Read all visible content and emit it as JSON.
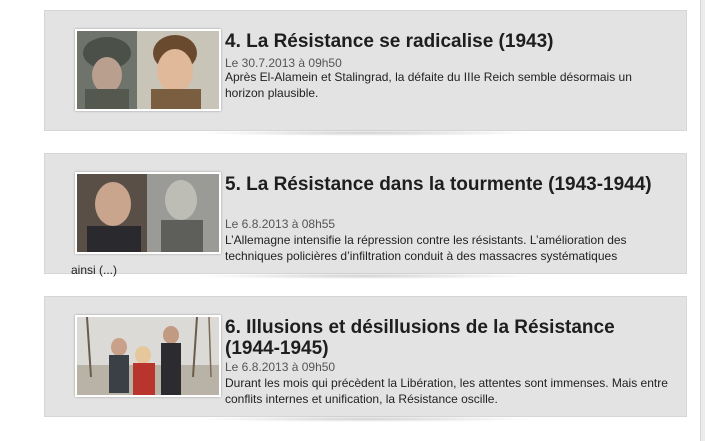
{
  "articles": [
    {
      "title": "4. La Résistance se radicalise (1943)",
      "date": "Le 30.7.2013 à 09h50",
      "summary": "Après El-Alamein et Stalingrad, la défaite du IIIe Reich semble désormais un horizon plausible.",
      "thumbnail": "soldier-and-young-man-still"
    },
    {
      "title": "5. La Résistance dans la tourmente (1943-1944)",
      "date": "Le 6.8.2013 à 08h55",
      "summary": "L’Allemagne intensifie la répression contre les résistants. L’amélioration des techniques policières d’infiltration conduit à des massacres systématiques",
      "overflow": "ainsi (...)",
      "thumbnail": "old-man-and-portrait-still"
    },
    {
      "title": "6. Illusions et désillusions de la Résistance (1944-1945)",
      "date": "Le 6.8.2013 à 09h50",
      "summary": "Durant les mois qui précèdent la Libération, les attentes sont immenses. Mais entre conflits internes et unification, la Résistance oscille.",
      "thumbnail": "group-in-winter-forest-still"
    }
  ]
}
